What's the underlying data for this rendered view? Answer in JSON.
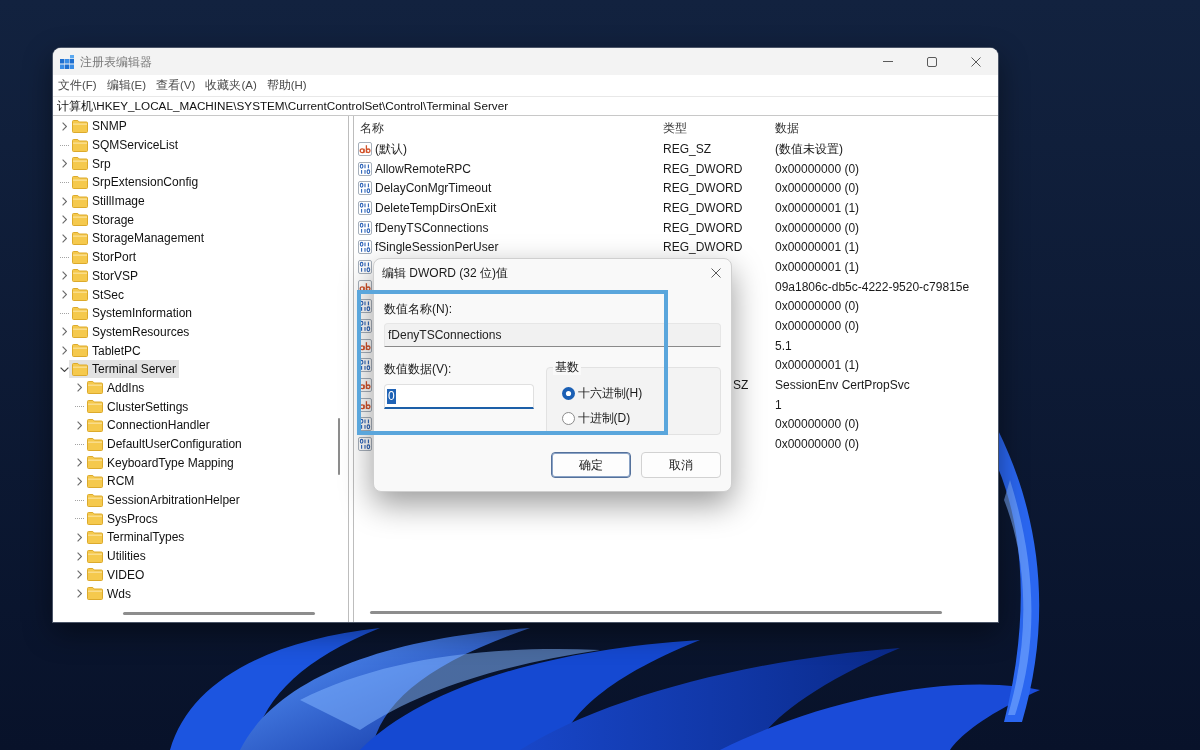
{
  "window": {
    "title": "注册表编辑器"
  },
  "menu": [
    "文件(F)",
    "编辑(E)",
    "查看(V)",
    "收藏夹(A)",
    "帮助(H)"
  ],
  "address": "计算机\\HKEY_LOCAL_MACHINE\\SYSTEM\\CurrentControlSet\\Control\\Terminal Server",
  "tree": [
    {
      "label": "SNMP",
      "expandable": true,
      "expanded": false,
      "selected": false
    },
    {
      "label": "SQMServiceList",
      "expandable": false,
      "selected": false
    },
    {
      "label": "Srp",
      "expandable": true,
      "expanded": false,
      "selected": false
    },
    {
      "label": "SrpExtensionConfig",
      "expandable": false,
      "selected": false
    },
    {
      "label": "StillImage",
      "expandable": true,
      "expanded": false,
      "selected": false
    },
    {
      "label": "Storage",
      "expandable": true,
      "expanded": false,
      "selected": false
    },
    {
      "label": "StorageManagement",
      "expandable": true,
      "expanded": false,
      "selected": false
    },
    {
      "label": "StorPort",
      "expandable": false,
      "selected": false
    },
    {
      "label": "StorVSP",
      "expandable": true,
      "expanded": false,
      "selected": false
    },
    {
      "label": "StSec",
      "expandable": true,
      "expanded": false,
      "selected": false
    },
    {
      "label": "SystemInformation",
      "expandable": false,
      "selected": false
    },
    {
      "label": "SystemResources",
      "expandable": true,
      "expanded": false,
      "selected": false
    },
    {
      "label": "TabletPC",
      "expandable": true,
      "expanded": false,
      "selected": false
    },
    {
      "label": "Terminal Server",
      "expandable": true,
      "expanded": true,
      "selected": true,
      "children": [
        {
          "label": "AddIns",
          "expandable": true,
          "expanded": false,
          "selected": false
        },
        {
          "label": "ClusterSettings",
          "expandable": false,
          "selected": false
        },
        {
          "label": "ConnectionHandler",
          "expandable": true,
          "expanded": false,
          "selected": false
        },
        {
          "label": "DefaultUserConfiguration",
          "expandable": false,
          "selected": false
        },
        {
          "label": "KeyboardType Mapping",
          "expandable": true,
          "expanded": false,
          "selected": false
        },
        {
          "label": "RCM",
          "expandable": true,
          "expanded": false,
          "selected": false
        },
        {
          "label": "SessionArbitrationHelper",
          "expandable": false,
          "selected": false
        },
        {
          "label": "SysProcs",
          "expandable": false,
          "selected": false
        },
        {
          "label": "TerminalTypes",
          "expandable": true,
          "expanded": false,
          "selected": false
        },
        {
          "label": "Utilities",
          "expandable": true,
          "expanded": false,
          "selected": false
        },
        {
          "label": "VIDEO",
          "expandable": true,
          "expanded": false,
          "selected": false
        },
        {
          "label": "Wds",
          "expandable": true,
          "expanded": false,
          "selected": false
        }
      ]
    }
  ],
  "value_list": {
    "columns": [
      "名称",
      "类型",
      "数据"
    ],
    "rows": [
      {
        "kind": "string",
        "name": "(默认)",
        "type": "REG_SZ",
        "data": "(数值未设置)"
      },
      {
        "kind": "dword",
        "name": "AllowRemoteRPC",
        "type": "REG_DWORD",
        "data": "0x00000000 (0)"
      },
      {
        "kind": "dword",
        "name": "DelayConMgrTimeout",
        "type": "REG_DWORD",
        "data": "0x00000000 (0)"
      },
      {
        "kind": "dword",
        "name": "DeleteTempDirsOnExit",
        "type": "REG_DWORD",
        "data": "0x00000001 (1)"
      },
      {
        "kind": "dword",
        "name": "fDenyTSConnections",
        "type": "REG_DWORD",
        "data": "0x00000000 (0)"
      },
      {
        "kind": "dword",
        "name": "fSingleSessionPerUser",
        "type": "REG_DWORD",
        "data": "0x00000001 (1)"
      },
      {
        "kind": "dword",
        "data": "0x00000001 (1)"
      },
      {
        "kind": "string",
        "data": "09a1806c-db5c-4222-9520-c79815e"
      },
      {
        "kind": "dword",
        "data": "0x00000000 (0)"
      },
      {
        "kind": "dword",
        "data": "0x00000000 (0)"
      },
      {
        "kind": "string",
        "data": "5.1"
      },
      {
        "kind": "dword",
        "data": "0x00000001 (1)"
      },
      {
        "kind": "string",
        "type": "SZ",
        "data": "SessionEnv CertPropSvc"
      },
      {
        "kind": "string",
        "data": "1"
      },
      {
        "kind": "dword",
        "data": "0x00000000 (0)"
      },
      {
        "kind": "dword",
        "data": "0x00000000 (0)"
      }
    ]
  },
  "dialog": {
    "title": "编辑 DWORD (32 位)值",
    "name_label": "数值名称(N):",
    "name_value": "fDenyTSConnections",
    "data_label": "数值数据(V):",
    "data_value": "0",
    "data_value_selected": true,
    "base": {
      "title": "基数",
      "options": [
        {
          "label": "十六进制(H)",
          "selected": true
        },
        {
          "label": "十进制(D)",
          "selected": false
        }
      ]
    },
    "buttons": [
      {
        "label": "确定",
        "default": true
      },
      {
        "label": "取消",
        "default": false
      }
    ]
  }
}
